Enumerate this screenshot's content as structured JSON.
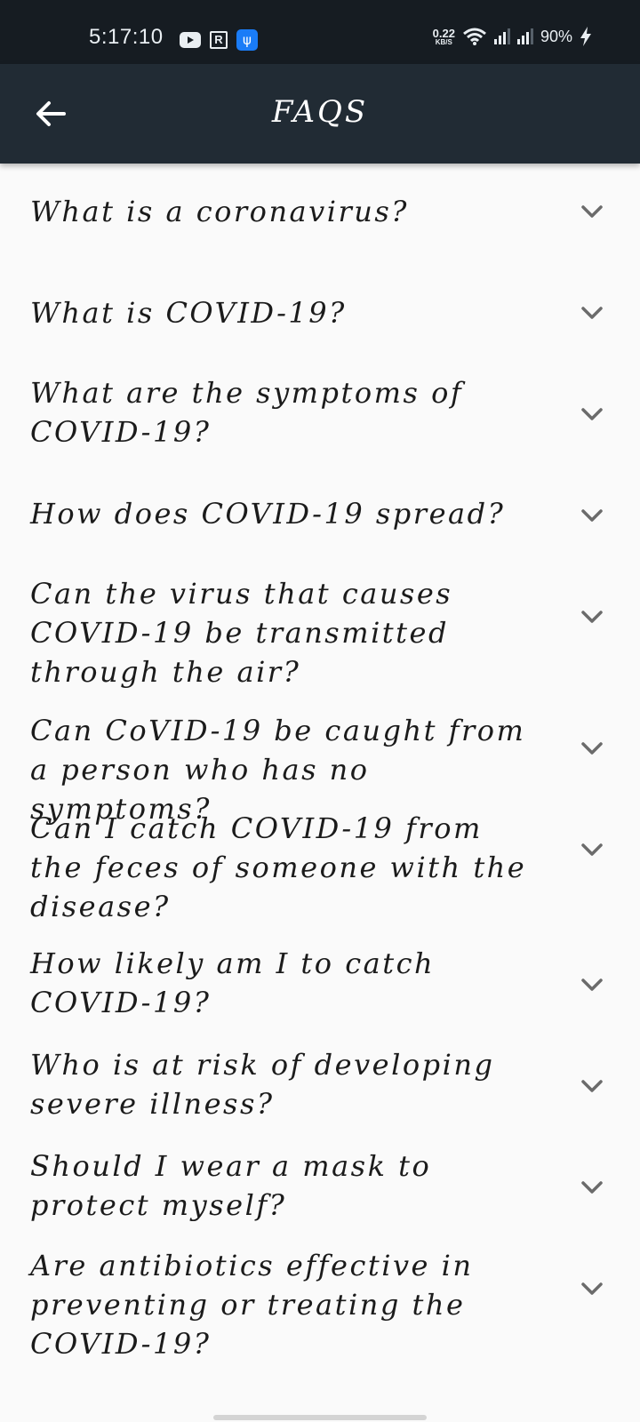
{
  "status_bar": {
    "time": "5:17:10",
    "net_speed_value": "0.22",
    "net_speed_unit": "KB/S",
    "battery": "90%",
    "icons": [
      "youtube-icon",
      "r-app-icon",
      "usb-icon",
      "wifi-icon",
      "signal-icon",
      "signal-icon",
      "charging-bolt-icon"
    ]
  },
  "app_bar": {
    "title": "FAQS",
    "back_icon": "arrow-left-icon"
  },
  "faqs": [
    {
      "question": "What is a coronavirus?"
    },
    {
      "question": "What is COVID-19?"
    },
    {
      "question": "What are the symptoms of COVID-19?"
    },
    {
      "question": "How does COVID-19 spread?"
    },
    {
      "question": "Can the virus that causes COVID-19 be transmitted through the air?"
    },
    {
      "question": "Can CoVID-19 be caught from a person who has no symptoms?"
    },
    {
      "question": "Can I catch COVID-19 from the feces of someone with the disease?"
    },
    {
      "question": "How likely am I to catch COVID-19?"
    },
    {
      "question": "Who is at risk of developing severe illness?"
    },
    {
      "question": "Should I wear a mask to protect myself?"
    },
    {
      "question": "Are antibiotics effective in preventing or treating the COVID-19?"
    }
  ],
  "colors": {
    "status_bar": "#161c22",
    "app_bar": "#212b34",
    "background": "#fafafa",
    "chevron": "#6b6b6b"
  }
}
